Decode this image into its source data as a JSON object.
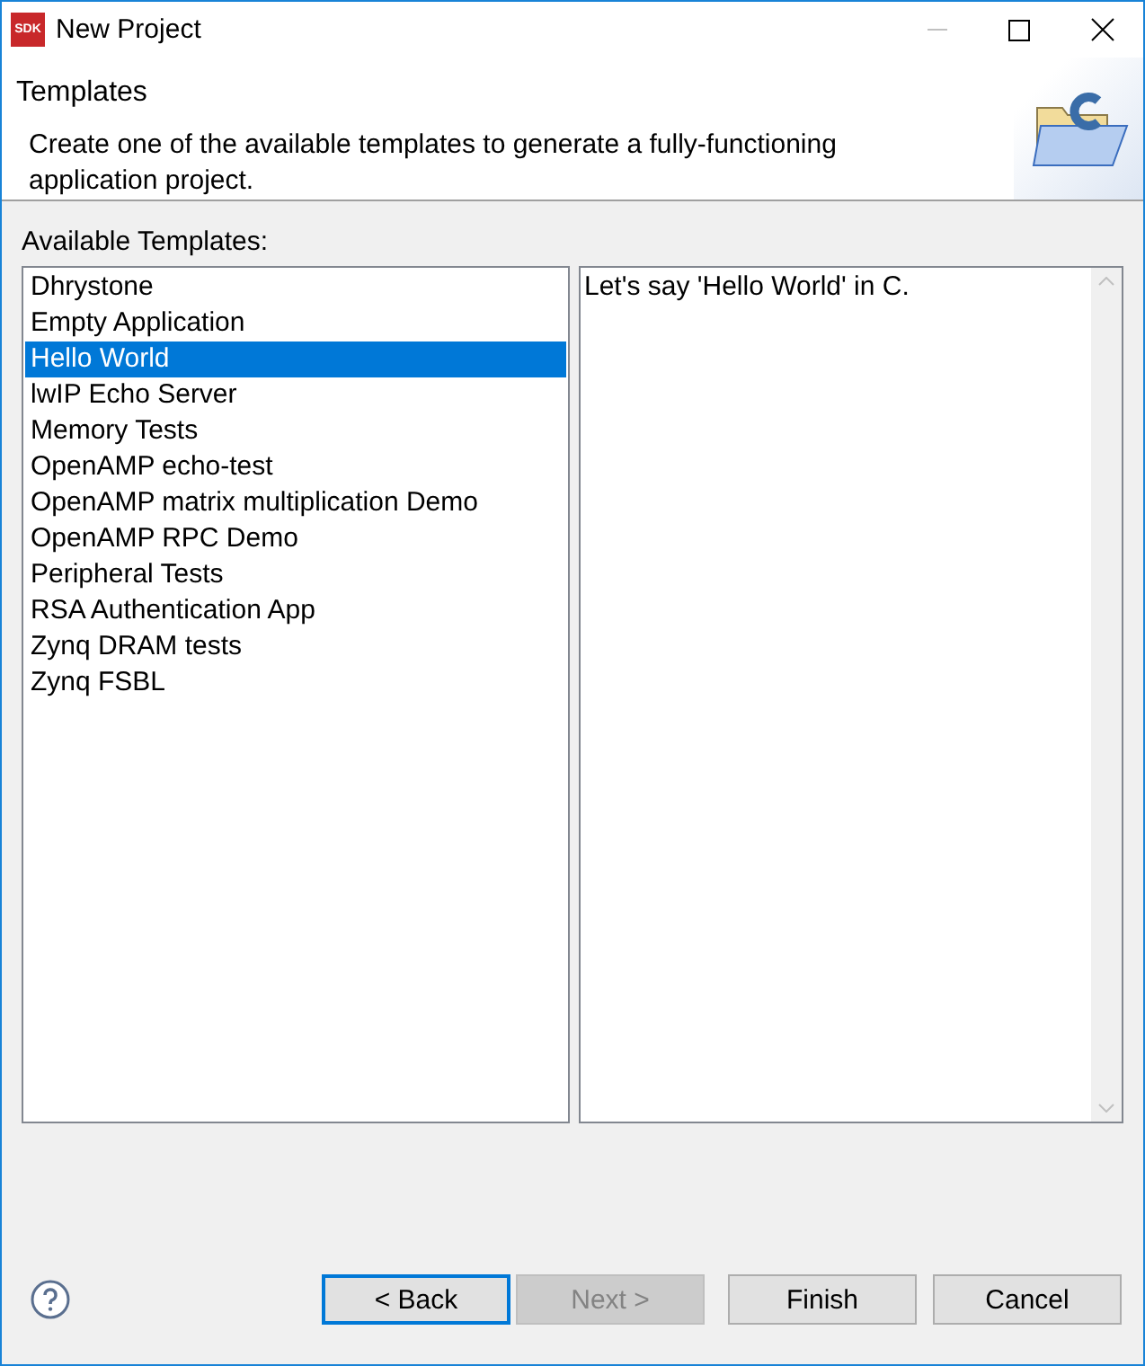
{
  "window": {
    "title": "New Project",
    "app_badge": "SDK"
  },
  "header": {
    "title": "Templates",
    "description": "Create one of the available templates to generate a fully-functioning application project."
  },
  "templates": {
    "label": "Available Templates:",
    "items": [
      {
        "label": "Dhrystone",
        "selected": false
      },
      {
        "label": "Empty Application",
        "selected": false
      },
      {
        "label": "Hello World",
        "selected": true
      },
      {
        "label": "lwIP Echo Server",
        "selected": false
      },
      {
        "label": "Memory Tests",
        "selected": false
      },
      {
        "label": "OpenAMP echo-test",
        "selected": false
      },
      {
        "label": "OpenAMP matrix multiplication Demo",
        "selected": false
      },
      {
        "label": "OpenAMP RPC Demo",
        "selected": false
      },
      {
        "label": "Peripheral Tests",
        "selected": false
      },
      {
        "label": "RSA Authentication App",
        "selected": false
      },
      {
        "label": "Zynq DRAM tests",
        "selected": false
      },
      {
        "label": "Zynq FSBL",
        "selected": false
      }
    ]
  },
  "description_panel": {
    "text": "Let's say 'Hello World' in C."
  },
  "buttons": [
    {
      "label": "< Back",
      "disabled": false,
      "focused": true
    },
    {
      "label": "Next >",
      "disabled": true,
      "focused": false
    },
    {
      "label": "Finish",
      "disabled": false,
      "focused": false
    },
    {
      "label": "Cancel",
      "disabled": false,
      "focused": false
    }
  ]
}
